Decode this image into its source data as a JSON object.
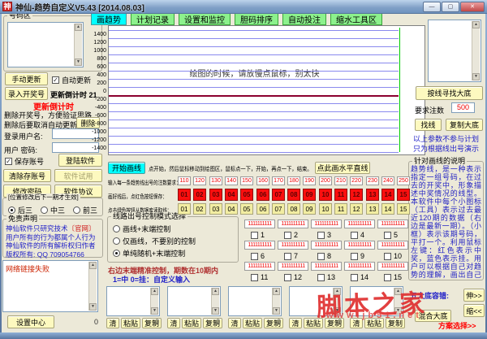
{
  "window": {
    "icon": "神",
    "title": "神仙-趋势自定义V5.43 [2014.08.03]",
    "minimize": "—",
    "maximize": "▢",
    "close": "✕"
  },
  "tabs": [
    {
      "label": "画趋势",
      "active": true
    },
    {
      "label": "计划记录",
      "active": false
    },
    {
      "label": "设置和监控",
      "active": false
    },
    {
      "label": "胆码排序",
      "active": false
    },
    {
      "label": "自动投注",
      "active": false
    },
    {
      "label": "缩水工具区",
      "active": false
    }
  ],
  "left": {
    "number_zone": "号码区",
    "manual_update": "手动更新",
    "auto_update": "自动更新",
    "enter_draw": "录入开奖号",
    "countdown_text": "更新倒计时 21",
    "countdown_red": "更新倒计时",
    "del_line1": "删除开奖号，方便验证思路",
    "del_line2": "删除后要取消自动更新",
    "delete_btn": "删除",
    "username": "登录用户名:",
    "password": "用户  密码:",
    "save_account": "保存账号",
    "login": "登陆软件",
    "clear_account": "清除存账号",
    "trial": "软件试用",
    "change_pwd": "修改密码",
    "agreement": "软件协议",
    "pos_title": "[位置修改后下一期才生效]",
    "pos_options": [
      {
        "label": "后三",
        "selected": true
      },
      {
        "label": "中三",
        "selected": false
      },
      {
        "label": "前三",
        "selected": false
      }
    ],
    "disclaimer_title": "免责声明",
    "disc1a": "神仙软件只研究技术",
    "disc1b": "〔官网〕",
    "disc2": "用户所有的行为都属个人行为",
    "disc3": "神仙软件的所有解析权归作者",
    "disc4": "版权所有: QQ 709054766",
    "network": "网络链接失败",
    "settings": "设置中心"
  },
  "chart_data": {
    "type": "line",
    "title": "",
    "xlabel": "",
    "ylabel": "",
    "y_ticks": [
      1400,
      1200,
      1000,
      800,
      600,
      400,
      200,
      0,
      -200,
      -400,
      -600,
      -800,
      -1000,
      -1200,
      -1400
    ],
    "ylim": [
      -1500,
      1500
    ],
    "series": [],
    "grid": "horizontal",
    "message": "绘图的时候，请放慢点鼠标，别太快",
    "grid_color": "#8a8aee",
    "zero_line_color": "#8b0030",
    "cursor_line_color": "#00cc00"
  },
  "draw": {
    "start": "开始画线",
    "hint": "点开始，然后鼠标移动到绘图区，鼠标点一下，开始，再点一下，结束。",
    "hline": "点此画水平直线",
    "bets_label": "输入每一条趋势线出号的注数要求：",
    "bets": [
      "110",
      "120",
      "130",
      "140",
      "150",
      "160",
      "170",
      "180",
      "190",
      "200",
      "210",
      "220",
      "230",
      "240",
      "250"
    ],
    "save_label": "画好线后，点红色按钮保存：",
    "saves": [
      "01",
      "02",
      "03",
      "04",
      "05",
      "06",
      "07",
      "08",
      "09",
      "10",
      "11",
      "12",
      "13",
      "14",
      "15"
    ],
    "load_label": "点击绿色按钮从数据库读取线：",
    "loads": [
      "01",
      "02",
      "03",
      "04",
      "05",
      "06",
      "07",
      "08",
      "09",
      "10",
      "11",
      "12",
      "13",
      "14",
      "15"
    ],
    "mode_title": "线路出号控制模式选择",
    "modes": [
      {
        "label": "画线+末端控制",
        "selected": false
      },
      {
        "label": "仅画线，不要别的控制",
        "selected": false
      },
      {
        "label": "单纯随机+末端控制",
        "selected": true
      }
    ],
    "note_red": "右边末端精准控制，期数在10期内",
    "note_blue": "1=中 0=挂：自定义输入",
    "cells": {
      "value": "1111111111",
      "labels": [
        "1",
        "2",
        "3",
        "4",
        "5",
        "6",
        "7",
        "8",
        "9",
        "10",
        "11",
        "12",
        "13",
        "14",
        "15"
      ],
      "checked": false
    }
  },
  "right": {
    "find_bottom": "按线寻找大底",
    "req_label": "要求注数",
    "req_value": "500",
    "find_line": "找线",
    "copy_bottom": "复制大底",
    "note1": "以上参数不参与计划",
    "note2": "只为根据线出号演示",
    "explain_title": "针对画线的说明",
    "explain_text": "趋势线，是一种表示指定一组号码，在过去的开奖中，形象描述中奖情况的线型。本软件中每个小图标（工具）表示过去最近120期的数据（右边是最新一期）。（小框）表示该期号码，平打一个。利用鼠标左键：红色表示中奖，蓝色表示挂。用户可以根据自己对趋势的理解，画出自己心目中最真实的趋势图形。画图的过程尽量放慢鼠标。"
  },
  "bottom": {
    "zero": "0",
    "clear": "清",
    "paste": "粘贴",
    "copy": "复制",
    "group_count": 5,
    "fault_label": "五大底容错:",
    "merge": "混合大底",
    "expand": "伸>>",
    "shrink": "缩<<",
    "plan": "方案选择>>"
  },
  "watermark": {
    "line1": "脚本之家",
    "line2": "www.jb51.net"
  }
}
